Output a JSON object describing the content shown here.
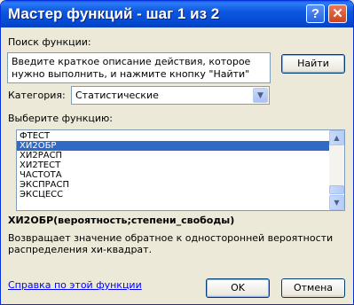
{
  "window": {
    "title": "Мастер функций - шаг 1 из 2",
    "help_icon": "?",
    "close_icon": "✕"
  },
  "search": {
    "label": "Поиск функции:",
    "value": "Введите краткое описание действия, которое нужно выполнить, и нажмите кнопку \"Найти\"",
    "find_button": "Найти"
  },
  "category": {
    "label": "Категория:",
    "selected": "Статистические",
    "arrow_icon": "chevron-down-icon"
  },
  "function_list": {
    "label": "Выберите функцию:",
    "items": [
      "ФТЕСТ",
      "ХИ2ОБР",
      "ХИ2РАСП",
      "ХИ2ТЕСТ",
      "ЧАСТОТА",
      "ЭКСПРАСП",
      "ЭКСЦЕСС"
    ],
    "selected_index": 1
  },
  "details": {
    "signature": "ХИ2ОБР(вероятность;степени_свободы)",
    "description": "Возвращает значение обратное к односторонней вероятности распределения хи-квадрат."
  },
  "footer": {
    "help_link": "Справка по этой функции",
    "ok": "OK",
    "cancel": "Отмена"
  },
  "colors": {
    "titlebar": "#0a5be8",
    "selection": "#316ac5",
    "link": "#0000ff"
  }
}
